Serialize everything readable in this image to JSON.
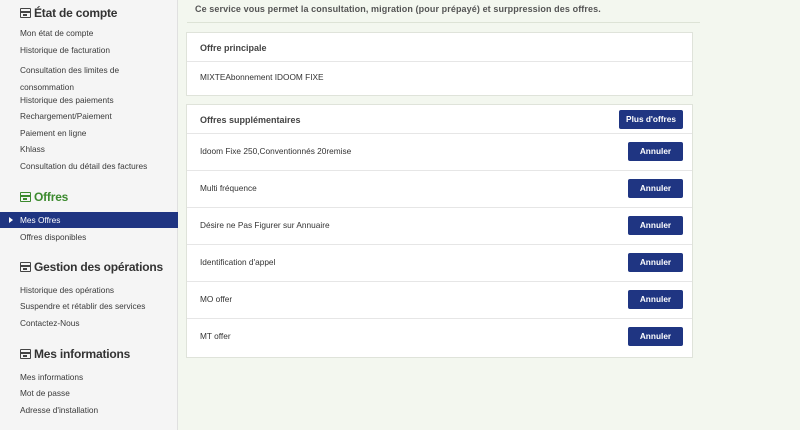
{
  "sidebar": {
    "sections": [
      {
        "title": "État de compte",
        "items": [
          "Mon état de compte",
          "Historique de facturation",
          "Consultation des limites de consommation",
          "Historique des paiements",
          "Rechargement/Paiement",
          "Paiement en ligne",
          "Khlass",
          "Consultation du détail des factures"
        ]
      },
      {
        "title": "Offres",
        "items": [
          "Mes Offres",
          "Offres disponibles"
        ]
      },
      {
        "title": "Gestion des opérations",
        "items": [
          "Historique des opérations",
          "Suspendre et rétablir des services",
          "Contactez-Nous"
        ]
      },
      {
        "title": "Mes informations",
        "items": [
          "Mes informations",
          "Mot de passe",
          "Adresse d'installation"
        ]
      }
    ],
    "active_item": "Mes Offres"
  },
  "main": {
    "intro": "Ce service vous permet la consultation, migration (pour prépayé) et surppression des offres.",
    "primary": {
      "title": "Offre principale",
      "value": "MIXTEAbonnement IDOOM FIXE"
    },
    "supplementary": {
      "title": "Offres supplémentaires",
      "more_label": "Plus d'offres",
      "cancel_label": "Annuler",
      "items": [
        "Idoom Fixe 250,Conventionnés 20remise",
        "Multi fréquence",
        "Désire ne Pas Figurer sur Annuaire",
        "Identification d'appel",
        "MO offer",
        "MT offer"
      ]
    }
  },
  "colors": {
    "accent": "#1f3582",
    "green": "#3c8a2e"
  }
}
